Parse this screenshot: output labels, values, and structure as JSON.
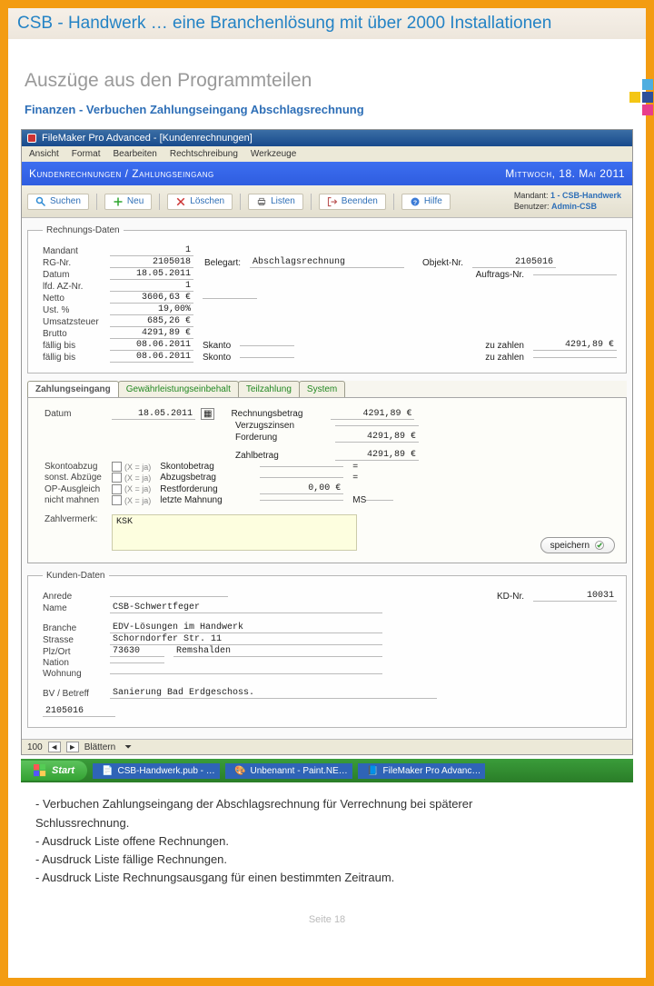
{
  "doc": {
    "title": "CSB - Handwerk … eine Branchenlösung mit über 2000 Installationen",
    "section": "Auszüge aus den Programmteilen",
    "sub": "Finanzen - Verbuchen Zahlungseingang Abschlagsrechnung",
    "footer": "Seite  18"
  },
  "app": {
    "title": "FileMaker Pro Advanced - [Kundenrechnungen]",
    "menu": [
      "Ansicht",
      "Format",
      "Bearbeiten",
      "Rechtschreibung",
      "Werkzeuge"
    ],
    "bluebar_left": "Kundenrechnungen / Zahlungseingang",
    "bluebar_right": "Mittwoch, 18. Mai 2011",
    "toolbar": {
      "suchen": "Suchen",
      "neu": "Neu",
      "loeschen": "Löschen",
      "listen": "Listen",
      "beenden": "Beenden",
      "hilfe": "Hilfe"
    },
    "meta": {
      "mandant_lbl": "Mandant:",
      "mandant_val": "1 - CSB-Handwerk",
      "benutzer_lbl": "Benutzer:",
      "benutzer_val": "Admin-CSB"
    }
  },
  "rechnung": {
    "legend": "Rechnungs-Daten",
    "l": {
      "mandant": "Mandant",
      "rgnr": "RG-Nr.",
      "datum": "Datum",
      "lfd": "lfd. AZ-Nr.",
      "netto": "Netto",
      "ust": "Ust. %",
      "umst": "Umsatzsteuer",
      "brutto": "Brutto",
      "faellig": "fällig bis",
      "faellig2": "fällig bis"
    },
    "v": {
      "mandant": "1",
      "rgnr": "2105018",
      "datum": "18.05.2011",
      "lfd": "1",
      "netto": "3606,63 €",
      "ust": "19,00%",
      "umst": "685,26 €",
      "brutto": "4291,89 €",
      "faellig": "08.06.2011",
      "faellig2": "08.06.2011"
    },
    "belegart_lbl": "Belegart:",
    "belegart_val": "Abschlagsrechnung",
    "objekt_lbl": "Objekt-Nr.",
    "objekt_val": "2105016",
    "auftrag_lbl": "Auftrags-Nr.",
    "skanto": "Skanto",
    "skonto": "Skonto",
    "zu_zahlen": "zu zahlen",
    "zu_zahlen_val": "4291,89 €"
  },
  "tabs": {
    "t1": "Zahlungseingang",
    "t2": "Gewährleistungseinbehalt",
    "t3": "Teilzahlung",
    "t4": "System"
  },
  "zahl": {
    "datum_lbl": "Datum",
    "datum_val": "18.05.2011",
    "rbetrag_lbl": "Rechnungsbetrag",
    "rbetrag_val": "4291,89 €",
    "verzug_lbl": "Verzugszinsen",
    "ford_lbl": "Forderung",
    "ford_val": "4291,89 €",
    "zahlb_lbl": "Zahlbetrag",
    "zahlb_val": "4291,89 €",
    "skontoabz_lbl": "Skontoabzug",
    "skontob_lbl": "Skontobetrag",
    "sonst_lbl": "sonst. Abzüge",
    "abzb_lbl": "Abzugsbetrag",
    "op_lbl": "OP-Ausgleich",
    "restf_lbl": "Restforderung",
    "restf_val": "0,00 €",
    "mahn_lbl": "nicht mahnen",
    "letzte_lbl": "letzte Mahnung",
    "ms": "MS",
    "xja": "(X = ja)",
    "vermerk_lbl": "Zahlvermerk:",
    "vermerk_val": "KSK",
    "speichern": "speichern"
  },
  "kunde": {
    "legend": "Kunden-Daten",
    "anrede": "Anrede",
    "name": "Name",
    "name_val": "CSB-Schwertfeger",
    "kdnr_lbl": "KD-Nr.",
    "kdnr_val": "10031",
    "branche": "Branche",
    "branche_val": "EDV-Lösungen im Handwerk",
    "strasse": "Strasse",
    "strasse_val": "Schorndorfer Str. 11",
    "plz": "Plz/Ort",
    "plz_val": "73630",
    "ort_val": "Remshalden",
    "nation": "Nation",
    "wohnung": "Wohnung",
    "bv": "BV / Betreff",
    "bv_val": "Sanierung Bad Erdgeschoss.",
    "obj": "2105016"
  },
  "status": {
    "rec": "100",
    "nav_l": "◄",
    "nav_r": "►",
    "blaettern": "Blättern"
  },
  "taskbar": {
    "start": "Start",
    "i1": "CSB-Handwerk.pub - …",
    "i2": "Unbenannt - Paint.NE…",
    "i3": "FileMaker Pro Advanc…"
  },
  "bullets": {
    "b1": "- Verbuchen Zahlungseingang der Abschlagsrechnung für Verrechnung bei späterer\n  Schlussrechnung.",
    "b2": "- Ausdruck Liste offene Rechnungen.",
    "b3": "- Ausdruck Liste fällige Rechnungen.",
    "b4": "- Ausdruck Liste Rechnungsausgang für einen bestimmten Zeitraum."
  }
}
